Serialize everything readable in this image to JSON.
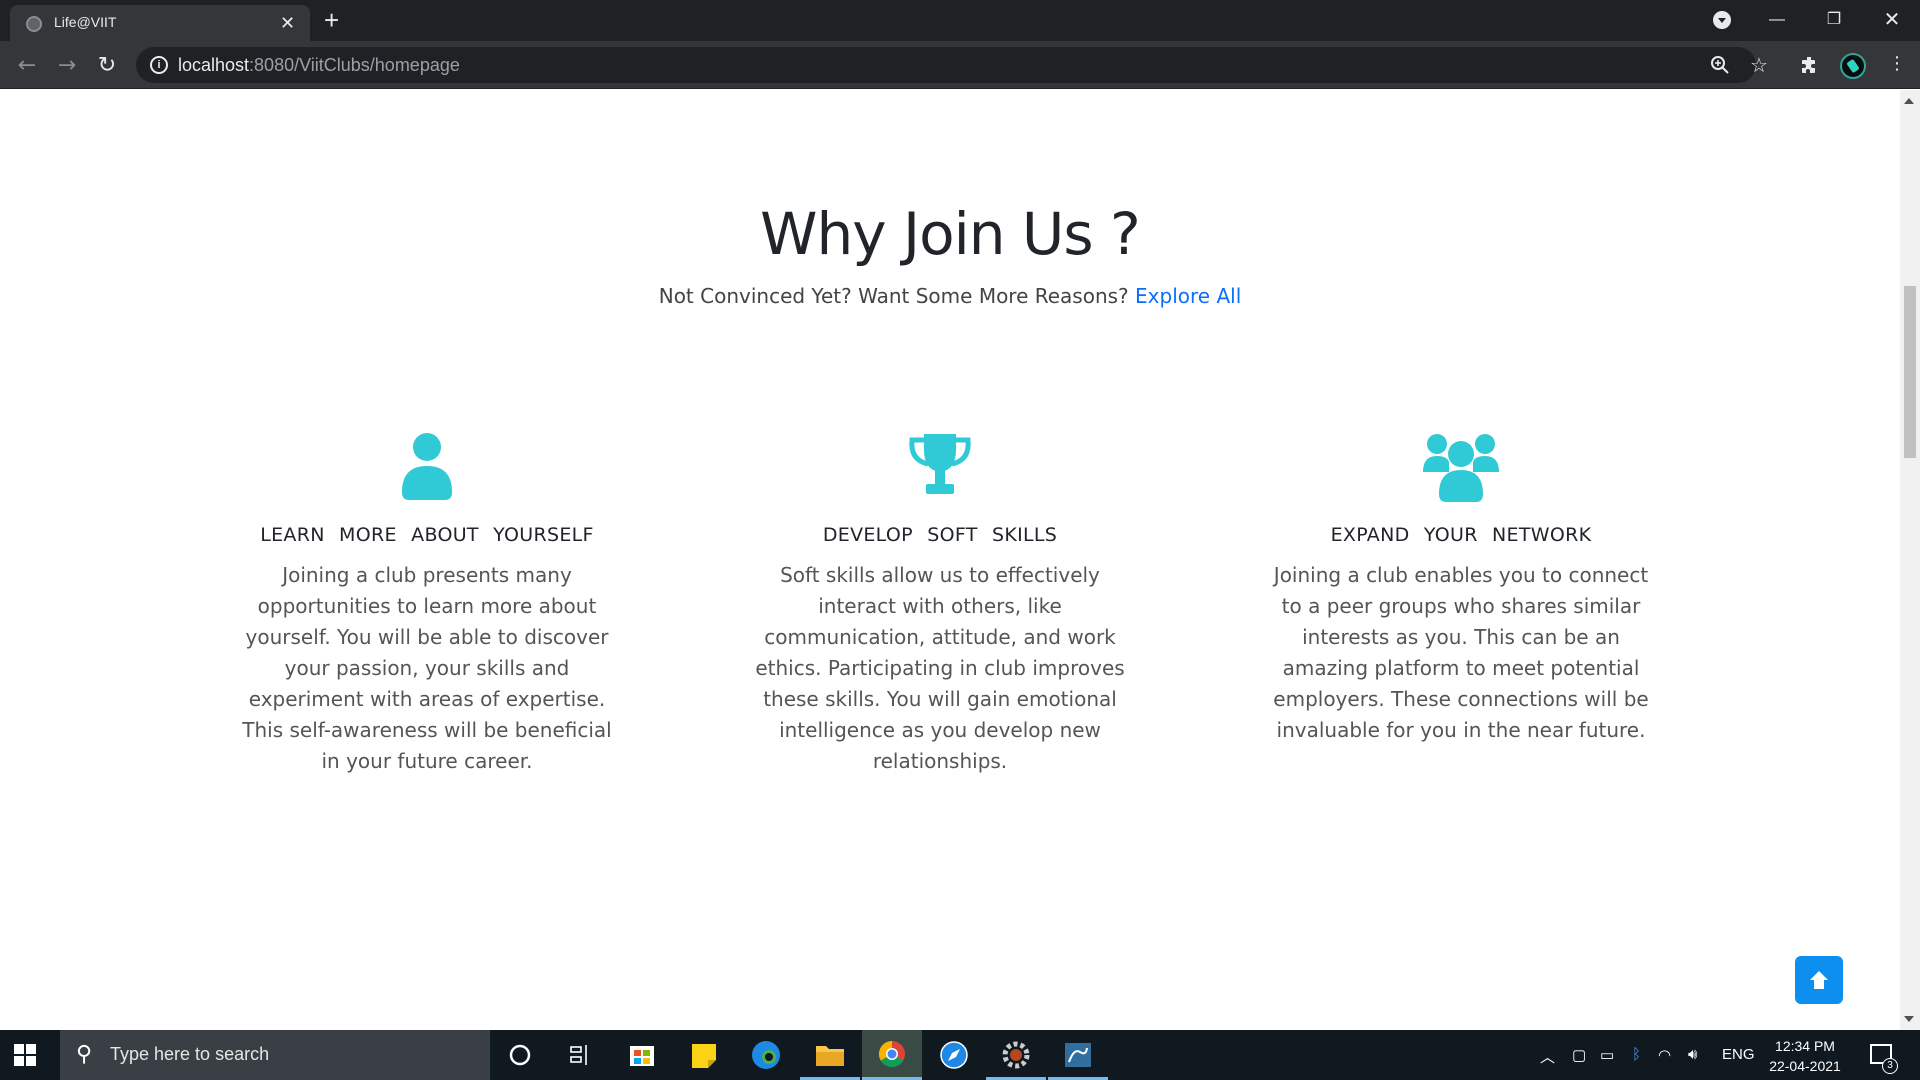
{
  "browser": {
    "tab_title": "Life@VIIT",
    "url_host": "localhost",
    "url_path": ":8080/ViitClubs/homepage"
  },
  "section": {
    "title": "Why Join Us ?",
    "subtitle": "Not Convinced Yet? Want Some More Reasons?",
    "explore_link": "Explore All"
  },
  "features": [
    {
      "icon": "user-icon",
      "heading": "LEARN MORE ABOUT YOURSELF",
      "text": "Joining a club presents many opportunities to learn more about yourself. You will be able to discover your passion, your skills and experiment with areas of expertise. This self-awareness will be beneficial in your future career."
    },
    {
      "icon": "trophy-icon",
      "heading": "DEVELOP SOFT SKILLS",
      "text": "Soft skills allow us to effectively interact with others, like communication, attitude, and work ethics. Participating in club improves these skills. You will gain emotional intelligence as you develop new relationships."
    },
    {
      "icon": "users-icon",
      "heading": "EXPAND YOUR NETWORK",
      "text": "Joining a club enables you to connect to a peer groups who shares similar interests as you. This can be an amazing platform to meet potential employers. These connections will be invaluable for you in the near future."
    }
  ],
  "colors": {
    "accent": "#30c9d6",
    "link": "#0d6efd",
    "scroll_top_button": "#0d8ff0"
  },
  "taskbar": {
    "search_placeholder": "Type here to search",
    "language": "ENG",
    "time": "12:34 PM",
    "date": "22-04-2021",
    "notification_count": "3"
  }
}
